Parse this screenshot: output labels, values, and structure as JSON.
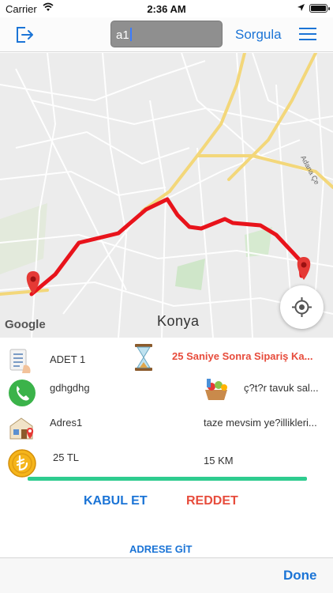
{
  "status_bar": {
    "carrier": "Carrier",
    "time": "2:36 AM"
  },
  "nav_bar": {
    "search_value": "a1",
    "query_label": "Sorgula",
    "icons": [
      "logout-icon",
      "hamburger-menu-icon"
    ]
  },
  "map": {
    "city_label": "Konya",
    "provider_label": "Google",
    "road_label": "Adana Çe",
    "route_color": "#e8131b"
  },
  "order": {
    "quantity": "ADET 1",
    "timer_text": "25 Saniye Sonra Sipariş Ka...",
    "customer_name": "gdhgdhg",
    "product_name": "ç?t?r tavuk sal...",
    "address": "Adres1",
    "description": "taze mevsim ye?illikleri...",
    "price": "25 TL",
    "distance": "15 KM"
  },
  "actions": {
    "accept_label": "KABUL ET",
    "reject_label": "REDDET",
    "goto_address_label": "ADRESE GİT"
  },
  "toolbar": {
    "done_label": "Done"
  },
  "colors": {
    "accent": "#1b74d6",
    "danger": "#e74c3c",
    "divider": "#2ecc8f"
  }
}
